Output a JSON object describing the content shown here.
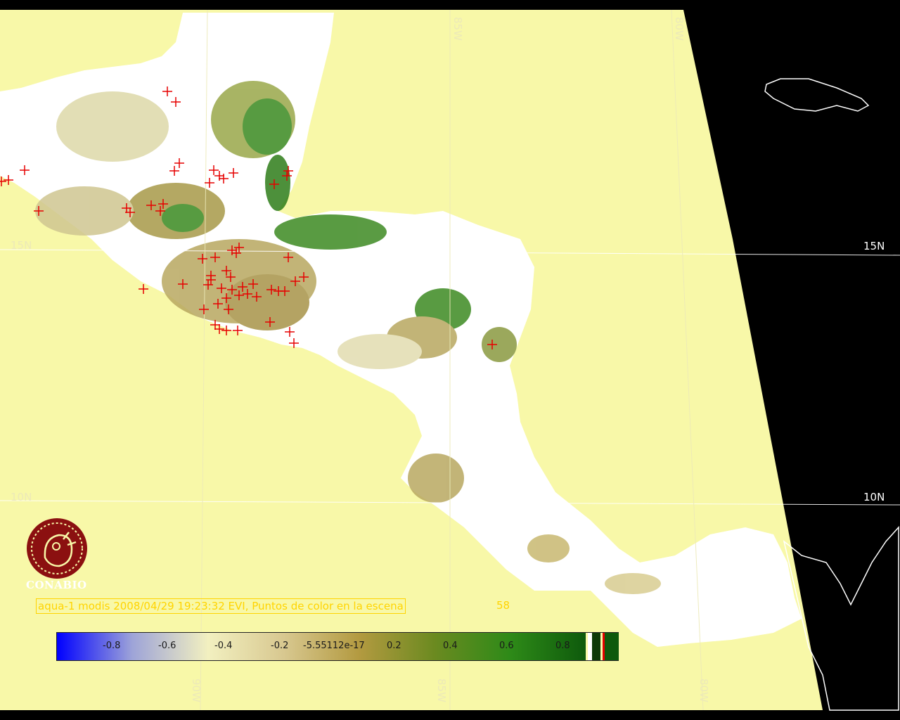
{
  "map": {
    "caption": "aqua-1 modis 2008/04/29 19:23:32 EVI, Puntos de color en la escena",
    "point_count": "58",
    "latitude_labels": [
      "15N",
      "10N"
    ],
    "longitude_labels": [
      "90W",
      "85W",
      "80W"
    ],
    "logo_text": "CONABIO",
    "colors": {
      "sea": "#f8f8a8",
      "land_white": "#ffffff",
      "vegetation_dark": "#2e7d1a",
      "vegetation_light": "#b7a64a",
      "fire_marker": "#e60000",
      "space": "#000000",
      "caption": "#ffd400"
    }
  },
  "colorbar": {
    "ticks": [
      "-0.8",
      "-0.6",
      "-0.4",
      "-0.2",
      "-5.55112e-17",
      "0.2",
      "0.4",
      "0.6",
      "0.8"
    ],
    "colors": [
      "#0000ff",
      "#9ea4d8",
      "#f2f0c0",
      "#d8c890",
      "#b39a40",
      "#6b8a20",
      "#2e8a18",
      "#0e5a0c"
    ]
  }
}
